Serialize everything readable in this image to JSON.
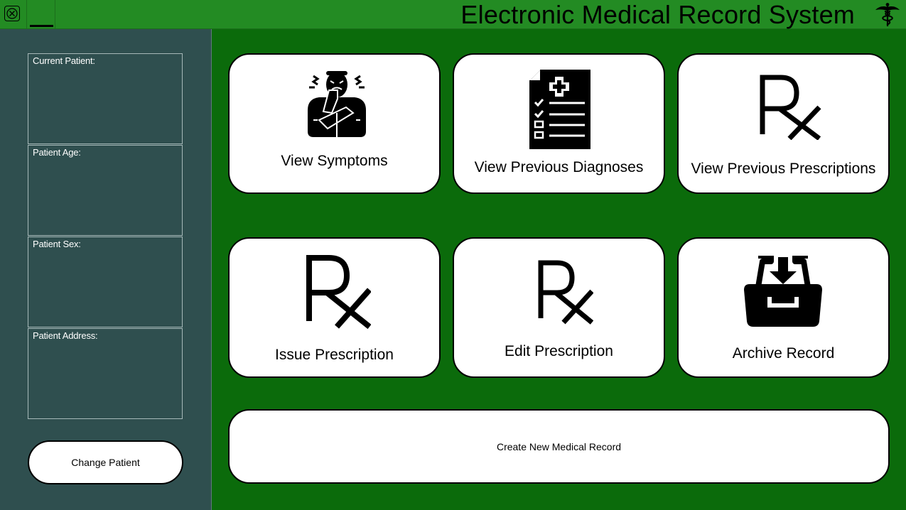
{
  "window": {
    "title": "Electronic Medical Record System",
    "close_icon": "close-icon",
    "logo_icon": "caduceus-icon"
  },
  "sidebar": {
    "fields": [
      {
        "label": "Current Patient:",
        "value": ""
      },
      {
        "label": "Patient Age:",
        "value": ""
      },
      {
        "label": "Patient Sex:",
        "value": ""
      },
      {
        "label": "Patient Address:",
        "value": ""
      }
    ],
    "change_patient_label": "Change Patient"
  },
  "actions": [
    {
      "label": "View Symptoms",
      "icon": "sick-person-icon"
    },
    {
      "label": "View Previous Diagnoses",
      "icon": "medical-report-icon"
    },
    {
      "label": "View Previous Prescriptions",
      "icon": "rx-icon"
    },
    {
      "label": "Issue Prescription",
      "icon": "rx-icon"
    },
    {
      "label": "Edit Prescription",
      "icon": "rx-icon"
    },
    {
      "label": "Archive Record",
      "icon": "archive-icon"
    }
  ],
  "create_record_label": "Create New Medical Record",
  "colors": {
    "titlebar": "#238b23",
    "main_background": "#0b6b0b",
    "sidebar": "#2f4f4f",
    "card": "#ffffff"
  }
}
